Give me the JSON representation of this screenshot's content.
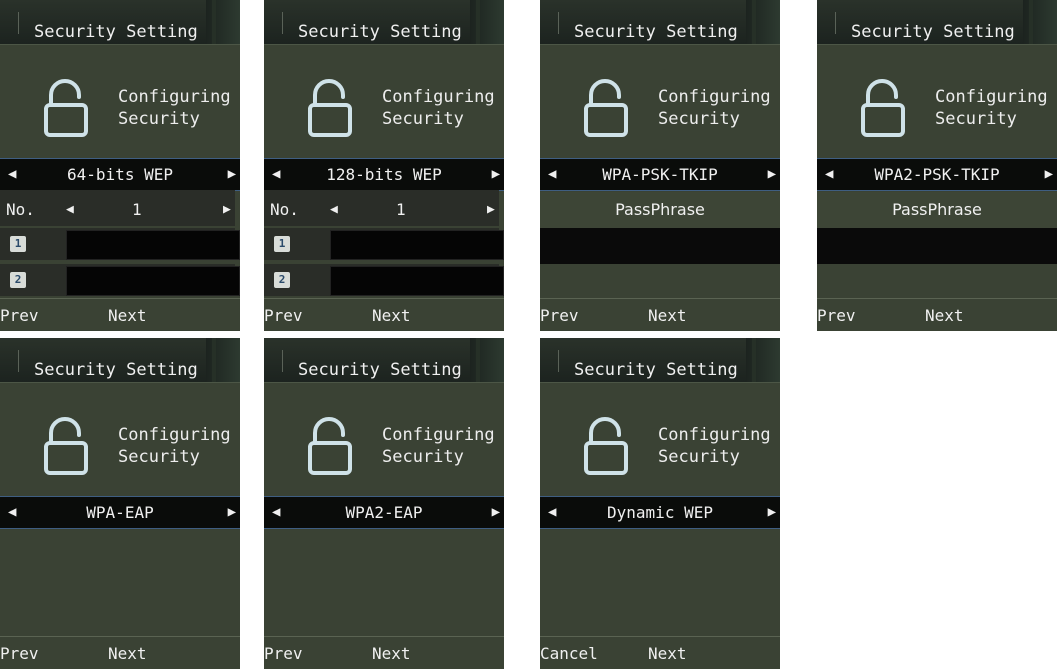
{
  "screens": [
    {
      "title": "Security Setting",
      "configuring": [
        "Configuring",
        "Security"
      ],
      "selection": "64-bits WEP",
      "number_label": "No.",
      "number_value": "1",
      "keys": [
        "1",
        "2"
      ],
      "softkey_left": "Prev",
      "softkey_right": "Next"
    },
    {
      "title": "Security Setting",
      "configuring": [
        "Configuring",
        "Security"
      ],
      "selection": "128-bits WEP",
      "number_label": "No.",
      "number_value": "1",
      "keys": [
        "1",
        "2"
      ],
      "softkey_left": "Prev",
      "softkey_right": "Next"
    },
    {
      "title": "Security Setting",
      "configuring": [
        "Configuring",
        "Security"
      ],
      "selection": "WPA-PSK-TKIP",
      "passphrase_label": "PassPhrase",
      "softkey_left": "Prev",
      "softkey_right": "Next"
    },
    {
      "title": "Security Setting",
      "configuring": [
        "Configuring",
        "Security"
      ],
      "selection": "WPA2-PSK-TKIP",
      "passphrase_label": "PassPhrase",
      "softkey_left": "Prev",
      "softkey_right": "Next"
    },
    {
      "title": "Security Setting",
      "configuring": [
        "Configuring",
        "Security"
      ],
      "selection": "WPA-EAP",
      "softkey_left": "Prev",
      "softkey_right": "Next"
    },
    {
      "title": "Security Setting",
      "configuring": [
        "Configuring",
        "Security"
      ],
      "selection": "WPA2-EAP",
      "softkey_left": "Prev",
      "softkey_right": "Next"
    },
    {
      "title": "Security Setting",
      "configuring": [
        "Configuring",
        "Security"
      ],
      "selection": "Dynamic WEP",
      "softkey_left": "Cancel",
      "softkey_right": "Next"
    }
  ],
  "icons": {
    "lock": "unlocked-padlock-icon",
    "left_arrow": "left-arrow-icon",
    "right_arrow": "right-arrow-icon"
  },
  "colors": {
    "screen_bg": "#3a4234",
    "selection_border": "#3f5e82",
    "field_bg": "#0a0a0a"
  }
}
